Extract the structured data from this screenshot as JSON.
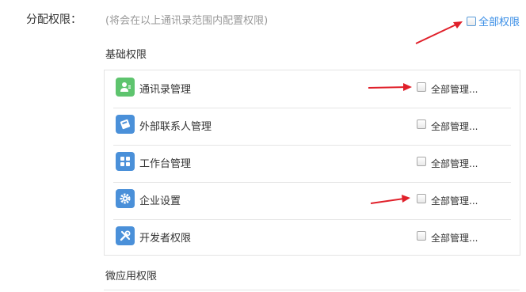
{
  "permissions": {
    "label": "分配权限：",
    "hint": "(将会在以上通讯录范围内配置权限)",
    "all_label": "全部权限"
  },
  "basic": {
    "title": "基础权限",
    "rows": [
      {
        "name": "通讯录管理",
        "manage_label": "全部管理...",
        "icon": "contacts-icon"
      },
      {
        "name": "外部联系人管理",
        "manage_label": "全部管理...",
        "icon": "external-contacts-icon"
      },
      {
        "name": "工作台管理",
        "manage_label": "全部管理...",
        "icon": "workbench-icon"
      },
      {
        "name": "企业设置",
        "manage_label": "全部管理...",
        "icon": "gear-icon"
      },
      {
        "name": "开发者权限",
        "manage_label": "全部管理...",
        "icon": "tools-icon"
      }
    ]
  },
  "micro": {
    "title": "微应用权限"
  },
  "colors": {
    "accent": "#3a8ee6",
    "arrow": "#e0202a",
    "icon_blue": "#4a90d9",
    "icon_green": "#5ec46e"
  }
}
